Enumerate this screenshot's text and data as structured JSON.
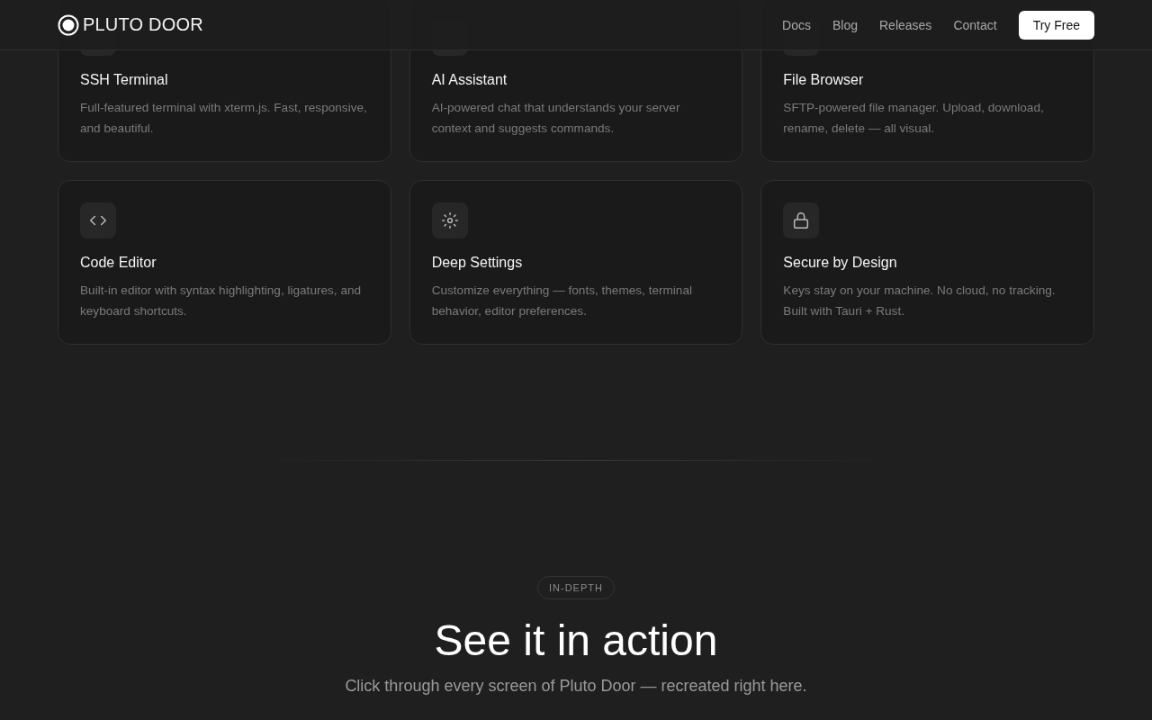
{
  "header": {
    "brand": "PLUTO DOOR",
    "nav": [
      "Docs",
      "Blog",
      "Releases",
      "Contact"
    ],
    "cta": "Try Free"
  },
  "features": [
    {
      "title": "SSH Terminal",
      "description": "Full-featured terminal with xterm.js. Fast, responsive, and beautiful."
    },
    {
      "title": "AI Assistant",
      "description": "AI-powered chat that understands your server context and suggests commands."
    },
    {
      "title": "File Browser",
      "description": "SFTP-powered file manager. Upload, download, rename, delete — all visual."
    },
    {
      "kind": "code",
      "title": "Code Editor",
      "description": "Built-in editor with syntax highlighting, ligatures, and keyboard shortcuts."
    },
    {
      "kind": "sun",
      "title": "Deep Settings",
      "description": "Customize everything — fonts, themes, terminal behavior, editor preferences."
    },
    {
      "kind": "lock",
      "title": "Secure by Design",
      "description": "Keys stay on your machine. No cloud, no tracking. Built with Tauri + Rust."
    }
  ],
  "section": {
    "badge": "IN-DEPTH",
    "heading": "See it in action",
    "subheading": "Click through every screen of Pluto Door — recreated right here."
  }
}
